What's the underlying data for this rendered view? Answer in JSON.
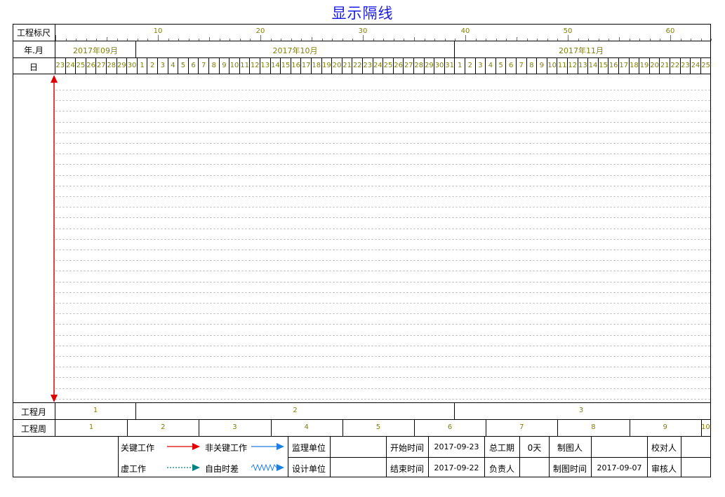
{
  "title": "显示隔线",
  "header": {
    "ruler_label": "工程标尺",
    "ruler_numbers": [
      "10",
      "20",
      "30",
      "40",
      "50",
      "60"
    ],
    "month_label": "年.月",
    "months": [
      "2017年09月",
      "2017年10月",
      "2017年11月"
    ],
    "day_label": "日",
    "days": [
      "23",
      "24",
      "25",
      "26",
      "27",
      "28",
      "29",
      "30",
      "1",
      "2",
      "3",
      "4",
      "5",
      "6",
      "7",
      "8",
      "9",
      "10",
      "11",
      "12",
      "13",
      "14",
      "15",
      "16",
      "17",
      "18",
      "19",
      "20",
      "21",
      "22",
      "23",
      "24",
      "25",
      "26",
      "27",
      "28",
      "29",
      "30",
      "31",
      "1",
      "2",
      "3",
      "4",
      "5",
      "6",
      "7",
      "8",
      "9",
      "10",
      "11",
      "12",
      "13",
      "14",
      "15",
      "16",
      "17",
      "18",
      "19",
      "20",
      "21",
      "22",
      "23",
      "24",
      "25"
    ]
  },
  "footer": {
    "project_month_label": "工程月",
    "project_months": [
      "1",
      "2",
      "3"
    ],
    "project_week_label": "工程周",
    "project_weeks": [
      "1",
      "2",
      "3",
      "4",
      "5",
      "6",
      "7",
      "8",
      "9",
      "10"
    ]
  },
  "legend": {
    "critical_work": "关键工作",
    "non_critical_work": "非关键工作",
    "virtual_work": "虚工作",
    "free_float": "自由时差"
  },
  "info": {
    "supervision_unit_label": "监理单位",
    "supervision_unit_value": "",
    "design_unit_label": "设计单位",
    "design_unit_value": "",
    "start_time_label": "开始时间",
    "start_time_value": "2017-09-23",
    "end_time_label": "结束时间",
    "end_time_value": "2017-09-22",
    "total_duration_label": "总工期",
    "total_duration_value": "0天",
    "responsible_label": "负责人",
    "responsible_value": "",
    "drafter_label": "制图人",
    "drafter_value": "",
    "draw_time_label": "制图时间",
    "draw_time_value": "2017-09-07",
    "checker_label": "校对人",
    "checker_value": "",
    "reviewer_label": "审核人",
    "reviewer_value": ""
  },
  "colors": {
    "title": "#1a1ae6",
    "critical": "#e00000",
    "non_critical": "#1e7fe0",
    "virtual": "#008080",
    "free_float": "#1e7fe0",
    "scale_text": "#80800a"
  }
}
